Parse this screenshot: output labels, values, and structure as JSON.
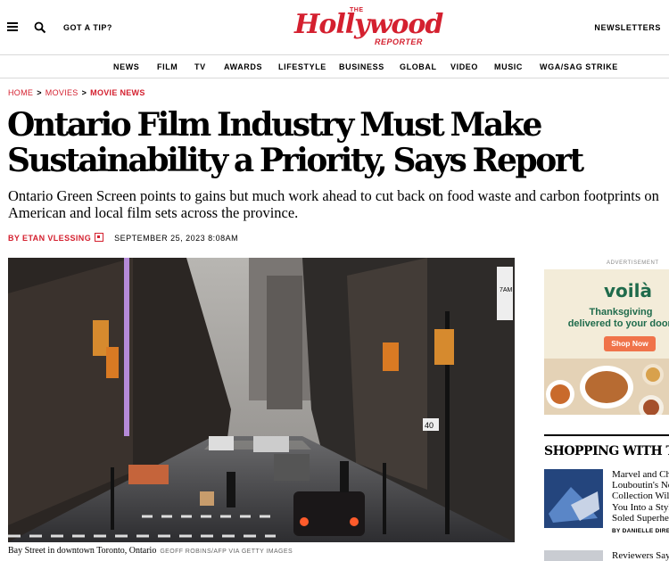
{
  "header": {
    "tip_label": "GOT A TIP?",
    "logo_the": "THE",
    "logo_name": "Hollywood",
    "logo_reporter": "REPORTER",
    "newsletters_label": "NEWSLETTERS",
    "brand_color": "#d4202f"
  },
  "nav": {
    "items": [
      "NEWS",
      "FILM",
      "TV",
      "AWARDS",
      "LIFESTYLE",
      "BUSINESS",
      "GLOBAL",
      "VIDEO",
      "MUSIC",
      "WGA/SAG STRIKE"
    ]
  },
  "breadcrumb": {
    "items": [
      "HOME",
      "MOVIES",
      "MOVIE NEWS"
    ],
    "separator": ">"
  },
  "article": {
    "headline": "Ontario Film Industry Must Make Sustainability a Priority, Says Report",
    "dek": "Ontario Green Screen points to gains but much work ahead to cut back on food waste and carbon footprints on American and local film sets across the province.",
    "byline_prefix": "BY",
    "author": "ETAN VLESSING",
    "date": "SEPTEMBER 25, 2023 8:08AM",
    "caption": "Bay Street in downtown Toronto, Ontario",
    "credit": "GEOFF ROBINS/AFP VIA GETTY IMAGES",
    "photo_signs": [
      "40",
      "7AM"
    ]
  },
  "sidebar": {
    "ad_label": "ADVERTISEMENT",
    "ad_brand": "voilà",
    "ad_promo": "Thanksgiving delivered to your door.",
    "ad_button": "Shop Now",
    "section_title": "SHOPPING WITH THR",
    "story1_title_lines": [
      "Marvel and Christian",
      "Louboutin's New",
      "Collection Will",
      "You Into a Stylish",
      "Soled Superhero"
    ],
    "story1_byline": "BY DANIELLE DIRECTO",
    "story2_title": "Reviewers Say"
  }
}
